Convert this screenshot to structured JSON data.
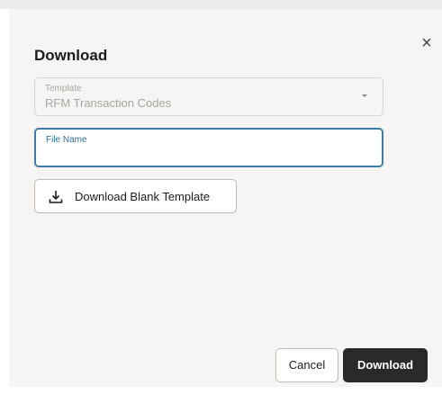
{
  "dialog": {
    "title": "Download",
    "close_icon": "close-icon"
  },
  "template_select": {
    "label": "Template",
    "value": "RFM Transaction Codes",
    "icon": "chevron-down-icon"
  },
  "file_name": {
    "label": "File Name",
    "value": ""
  },
  "blank_template_button": {
    "label": "Download Blank Template",
    "icon": "download-icon"
  },
  "footer": {
    "cancel_label": "Cancel",
    "download_label": "Download"
  },
  "colors": {
    "focus_border": "#3c7ca8",
    "primary_button": "#2b2a28",
    "dialog_background": "#f6f5f3"
  }
}
